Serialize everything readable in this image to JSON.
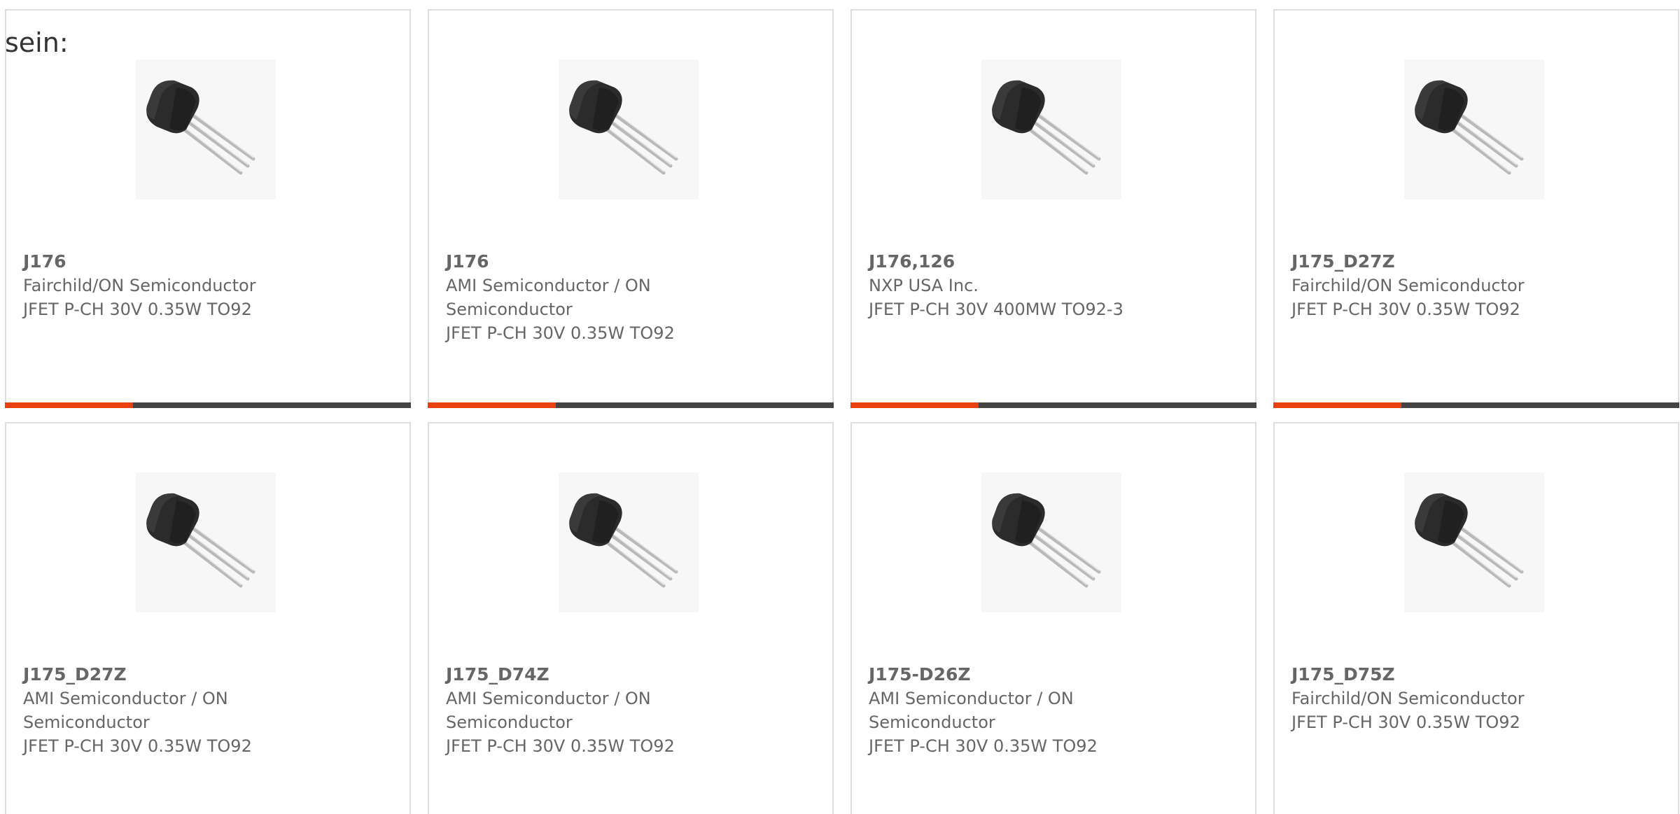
{
  "intro": {
    "text": "sein:"
  },
  "products": [
    {
      "part_number": "J176",
      "manufacturer_lines": [
        "Fairchild/ON Semiconductor"
      ],
      "description": "JFET P-CH 30V 0.35W TO92",
      "image_icon": "to92-transistor-icon",
      "has_accent_bar": true
    },
    {
      "part_number": "J176",
      "manufacturer_lines": [
        "AMI Semiconductor / ON",
        "Semiconductor"
      ],
      "description": "JFET P-CH 30V 0.35W TO92",
      "image_icon": "to92-transistor-icon",
      "has_accent_bar": true
    },
    {
      "part_number": "J176,126",
      "manufacturer_lines": [
        "NXP USA Inc."
      ],
      "description": "JFET P-CH 30V 400MW TO92-3",
      "image_icon": "to92-transistor-icon",
      "has_accent_bar": true
    },
    {
      "part_number": "J175_D27Z",
      "manufacturer_lines": [
        "Fairchild/ON Semiconductor"
      ],
      "description": "JFET P-CH 30V 0.35W TO92",
      "image_icon": "to92-transistor-icon",
      "has_accent_bar": true
    },
    {
      "part_number": "J175_D27Z",
      "manufacturer_lines": [
        "AMI Semiconductor / ON",
        "Semiconductor"
      ],
      "description": "JFET P-CH 30V 0.35W TO92",
      "image_icon": "to92-transistor-icon",
      "has_accent_bar": false
    },
    {
      "part_number": "J175_D74Z",
      "manufacturer_lines": [
        "AMI Semiconductor / ON",
        "Semiconductor"
      ],
      "description": "JFET P-CH 30V 0.35W TO92",
      "image_icon": "to92-transistor-icon",
      "has_accent_bar": false
    },
    {
      "part_number": "J175-D26Z",
      "manufacturer_lines": [
        "AMI Semiconductor / ON",
        "Semiconductor"
      ],
      "description": "JFET P-CH 30V 0.35W TO92",
      "image_icon": "to92-transistor-icon",
      "has_accent_bar": false
    },
    {
      "part_number": "J175_D75Z",
      "manufacturer_lines": [
        "Fairchild/ON Semiconductor"
      ],
      "description": "JFET P-CH 30V 0.35W TO92",
      "image_icon": "to92-transistor-icon",
      "has_accent_bar": false
    }
  ],
  "colors": {
    "accent": "#e8400e",
    "bar": "#444444",
    "text": "#666666",
    "border": "#dedede"
  }
}
